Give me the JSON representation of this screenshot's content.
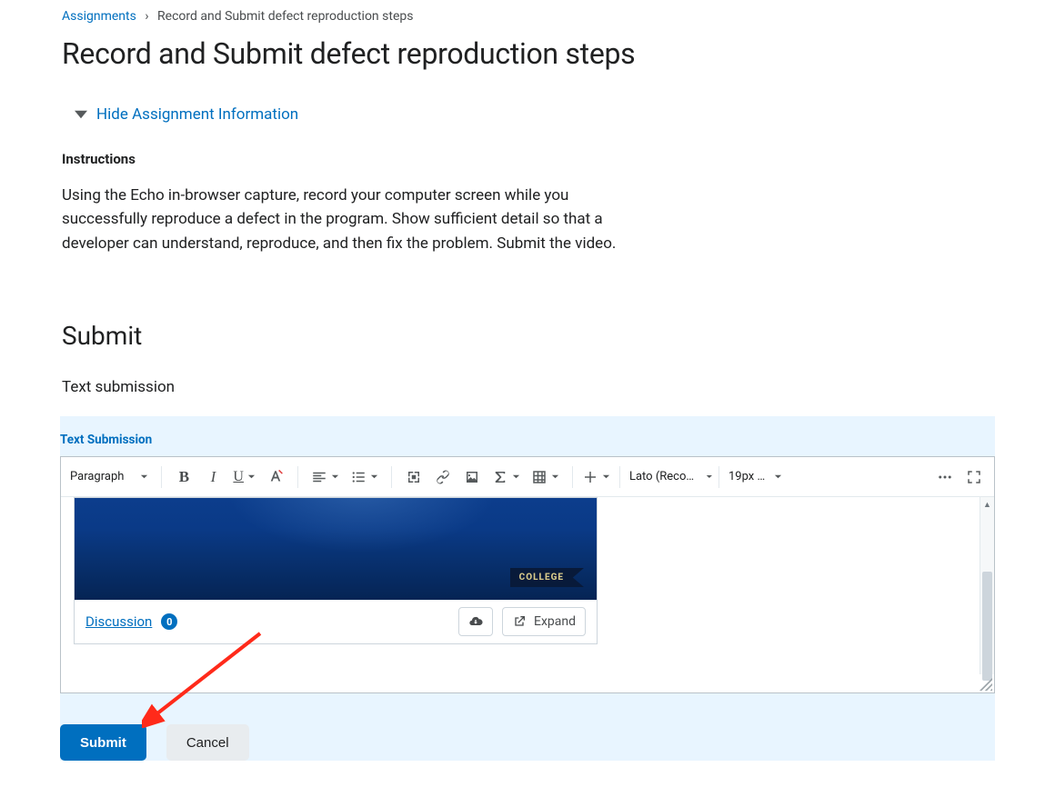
{
  "breadcrumb": {
    "root": "Assignments",
    "separator": "›",
    "current": "Record and Submit defect reproduction steps"
  },
  "page_title": "Record and Submit defect reproduction steps",
  "hide_info_label": "Hide Assignment Information",
  "instructions_label": "Instructions",
  "instructions_text": "Using the Echo in-browser capture, record your computer screen while you successfully reproduce a defect in the program. Show sufficient detail so that a developer can understand, reproduce, and then fix the problem. Submit the video.",
  "submit_heading": "Submit",
  "text_submission_subheading": "Text submission",
  "editor_label": "Text Submission",
  "toolbar": {
    "paragraph": "Paragraph",
    "font": "Lato (Recom...",
    "size": "19px …"
  },
  "embed": {
    "pennant": "COLLEGE",
    "discussion_label": "Discussion",
    "discussion_count": "0",
    "expand_label": "Expand"
  },
  "buttons": {
    "submit": "Submit",
    "cancel": "Cancel"
  }
}
